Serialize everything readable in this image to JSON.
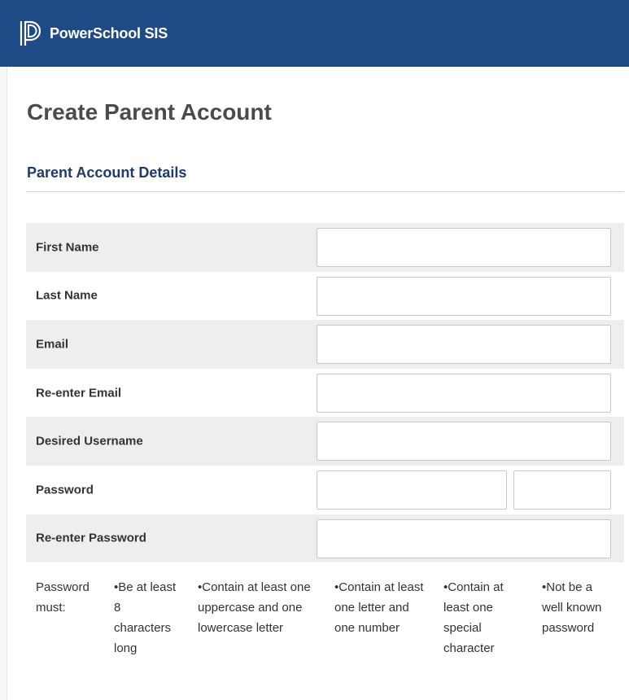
{
  "header": {
    "brand": "PowerSchool SIS",
    "logo_icon": "powerschool-logo-icon",
    "background": "#1e4a86"
  },
  "page": {
    "title": "Create Parent Account",
    "section_title": "Parent Account Details"
  },
  "form": {
    "first_name_label": "First Name",
    "first_name_value": "",
    "last_name_label": "Last Name",
    "last_name_value": "",
    "email_label": "Email",
    "email_value": "",
    "reenter_email_label": "Re-enter Email",
    "reenter_email_value": "",
    "username_label": "Desired Username",
    "username_value": "",
    "password_label": "Password",
    "password_value": "",
    "reenter_password_label": "Re-enter Password",
    "reenter_password_value": ""
  },
  "password_rules": {
    "intro": "Password must:",
    "rules": [
      "•Be at least 8 characters long",
      "•Contain at least one uppercase and one lowercase letter",
      "•Contain at least one letter and one number",
      "•Contain at least one special character",
      "•Not be a well known password"
    ]
  }
}
